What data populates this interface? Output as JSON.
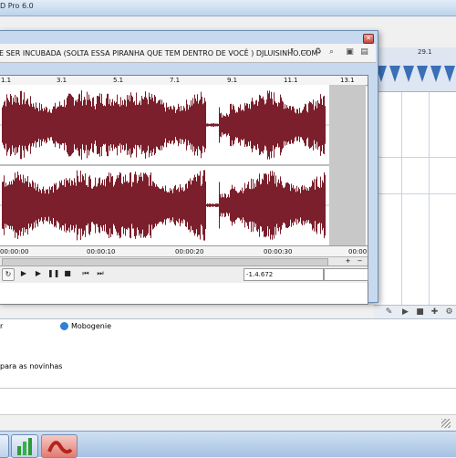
{
  "app": {
    "title": "D Pro 6.0",
    "ruler_label": "29.1",
    "list_items": [
      {
        "text": "r"
      },
      {
        "text": "Mobogenie"
      },
      {
        "text": "para as novinhas"
      }
    ]
  },
  "editor": {
    "file_title": "E SER INCUBADA (SOLTA ESSA PIRANHA QUE TEM DENTRO DE VOCÊ ) DJLUISINHO.COM",
    "top_ticks": [
      "1.1",
      "3.1",
      "5.1",
      "7.1",
      "9.1",
      "11.1",
      "13.1"
    ],
    "bottom_ticks": [
      "00:00:00",
      "00:00:10",
      "00:00:20",
      "00:00:30",
      "00:00"
    ],
    "position_readout": "-1.4.672",
    "waveform_color": "#7a1f2b",
    "accent_blue": "#3b6fb7"
  }
}
